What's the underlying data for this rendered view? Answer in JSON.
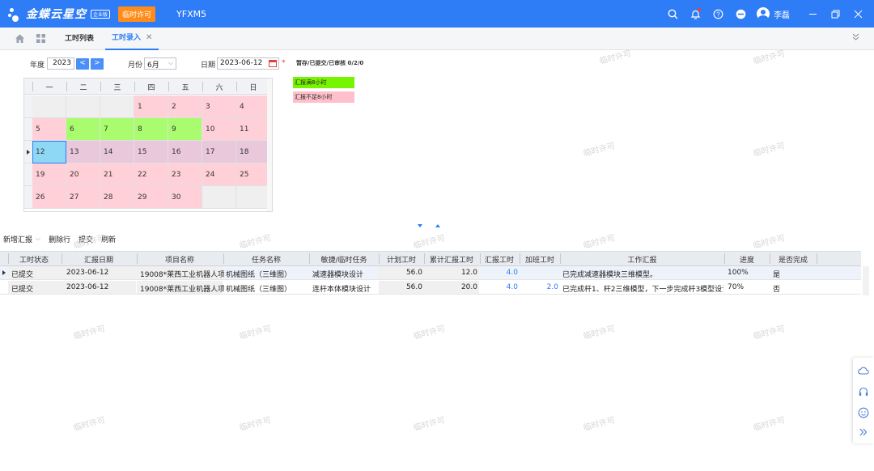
{
  "brand": {
    "name": "金蝶云星空",
    "edition": "企业版"
  },
  "license_badge": "临时许可",
  "tenant": "YFXM5",
  "user": {
    "name": "李磊"
  },
  "tabs": [
    {
      "label": "工时列表"
    },
    {
      "label": "工时录入"
    }
  ],
  "filter": {
    "year_label": "年度",
    "year_value": "2023",
    "prev": "<",
    "next": ">",
    "month_label": "月份",
    "month_value": "6月",
    "date_label": "日期",
    "date_value": "2023-06-12",
    "required_mark": "*"
  },
  "status_summary": "暂存/已提交/已审核 0/2/0",
  "weekdays": [
    "一",
    "二",
    "三",
    "四",
    "五",
    "六",
    "日"
  ],
  "calendar": [
    [
      {
        "d": "",
        "s": "empty"
      },
      {
        "d": "",
        "s": "empty"
      },
      {
        "d": "",
        "s": "empty"
      },
      {
        "d": "1",
        "s": "pink"
      },
      {
        "d": "2",
        "s": "pink"
      },
      {
        "d": "3",
        "s": "pink"
      },
      {
        "d": "4",
        "s": "pink"
      }
    ],
    [
      {
        "d": "5",
        "s": "pink"
      },
      {
        "d": "6",
        "s": "green"
      },
      {
        "d": "7",
        "s": "green"
      },
      {
        "d": "8",
        "s": "green"
      },
      {
        "d": "9",
        "s": "green"
      },
      {
        "d": "10",
        "s": "pink"
      },
      {
        "d": "11",
        "s": "pink"
      }
    ],
    [
      {
        "d": "12",
        "s": "today"
      },
      {
        "d": "13",
        "s": "sel-row"
      },
      {
        "d": "14",
        "s": "sel-row"
      },
      {
        "d": "15",
        "s": "sel-row"
      },
      {
        "d": "16",
        "s": "sel-row"
      },
      {
        "d": "17",
        "s": "sel-row"
      },
      {
        "d": "18",
        "s": "sel-row"
      }
    ],
    [
      {
        "d": "19",
        "s": "pink"
      },
      {
        "d": "20",
        "s": "pink"
      },
      {
        "d": "21",
        "s": "pink"
      },
      {
        "d": "22",
        "s": "pink"
      },
      {
        "d": "23",
        "s": "pink"
      },
      {
        "d": "24",
        "s": "pink"
      },
      {
        "d": "25",
        "s": "pink"
      }
    ],
    [
      {
        "d": "26",
        "s": "pink"
      },
      {
        "d": "27",
        "s": "pink"
      },
      {
        "d": "28",
        "s": "pink"
      },
      {
        "d": "29",
        "s": "pink"
      },
      {
        "d": "30",
        "s": "pink"
      },
      {
        "d": "",
        "s": "empty"
      },
      {
        "d": "",
        "s": "empty"
      }
    ]
  ],
  "legend": {
    "full": "汇报满8小时",
    "short": "汇报不足8小时"
  },
  "toolbar": {
    "add": "新增汇报",
    "delete": "删除行",
    "submit": "提交",
    "refresh": "刷新"
  },
  "table": {
    "columns": [
      "工时状态",
      "汇报日期",
      "项目名称",
      "任务名称",
      "敏捷/临时任务",
      "计划工时",
      "累计汇报工时",
      "汇报工时",
      "加班工时",
      "工作汇报",
      "进度",
      "是否完成"
    ],
    "rows": [
      [
        "已提交",
        "2023-06-12",
        "19008*莱西工业机器人项目",
        "机械图纸（三维图）",
        "减速器模块设计",
        "56.0",
        "12.0",
        "4.0",
        "",
        "已完成减速器模块三维模型。",
        "100%",
        "是"
      ],
      [
        "已提交",
        "2023-06-12",
        "19008*莱西工业机器人项目",
        "机械图纸（三维图）",
        "连杆本体模块设计",
        "56.0",
        "20.0",
        "4.0",
        "2.0",
        "已完成杆1、杆2三维模型，下一步完成杆3模型设计",
        "70%",
        "否"
      ]
    ]
  },
  "watermark": "临时许可",
  "colors": {
    "primary": "#2e7cf6",
    "badge": "#ff8c1a",
    "full_hours": "#77f400",
    "short_hours": "#ffc0cb"
  }
}
